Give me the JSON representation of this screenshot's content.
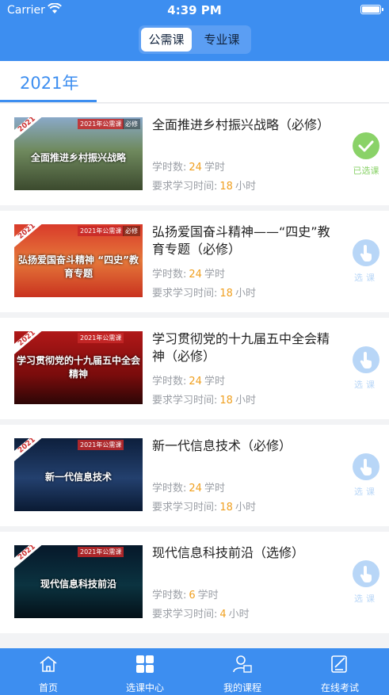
{
  "status": {
    "carrier": "Carrier",
    "time": "4:39 PM"
  },
  "header": {
    "tabs": [
      {
        "label": "公需课",
        "active": true
      },
      {
        "label": "专业课",
        "active": false
      }
    ]
  },
  "year_tab": "2021年",
  "courses": [
    {
      "thumb_tag": "2021年公需课",
      "thumb_req": "必修",
      "thumb_year": "2021",
      "thumb_headline": "全面推进乡村振兴战略",
      "title": "全面推进乡村振兴战略（必修）",
      "hours_label": "学时数:",
      "hours": "24",
      "hours_unit": "学时",
      "time_label": "要求学习时间:",
      "time": "18",
      "time_unit": "小时",
      "status": "已选课",
      "selected": true
    },
    {
      "thumb_tag": "2021年公需课",
      "thumb_req": "必修",
      "thumb_year": "2021",
      "thumb_headline": "弘扬爱国奋斗精神 “四史”教育专题",
      "title": "弘扬爱国奋斗精神——“四史”教育专题（必修）",
      "hours_label": "学时数:",
      "hours": "24",
      "hours_unit": "学时",
      "time_label": "要求学习时间:",
      "time": "18",
      "time_unit": "小时",
      "status": "选课",
      "selected": false
    },
    {
      "thumb_tag": "2021年公需课",
      "thumb_req": "",
      "thumb_year": "2021",
      "thumb_headline": "学习贯彻党的十九届五中全会精神",
      "title": "学习贯彻党的十九届五中全会精神（必修）",
      "hours_label": "学时数:",
      "hours": "24",
      "hours_unit": "学时",
      "time_label": "要求学习时间:",
      "time": "18",
      "time_unit": "小时",
      "status": "选课",
      "selected": false
    },
    {
      "thumb_tag": "2021年公需课",
      "thumb_req": "",
      "thumb_year": "2021",
      "thumb_headline": "新一代信息技术",
      "title": "新一代信息技术（必修）",
      "hours_label": "学时数:",
      "hours": "24",
      "hours_unit": "学时",
      "time_label": "要求学习时间:",
      "time": "18",
      "time_unit": "小时",
      "status": "选课",
      "selected": false
    },
    {
      "thumb_tag": "2021年公需课",
      "thumb_req": "",
      "thumb_year": "2021",
      "thumb_headline": "现代信息科技前沿",
      "title": "现代信息科技前沿（选修）",
      "hours_label": "学时数:",
      "hours": "6",
      "hours_unit": "学时",
      "time_label": "要求学习时间:",
      "time": "4",
      "time_unit": "小时",
      "status": "选课",
      "selected": false
    }
  ],
  "tabbar": [
    {
      "label": "首页",
      "icon": "home-icon"
    },
    {
      "label": "选课中心",
      "icon": "grid-icon"
    },
    {
      "label": "我的课程",
      "icon": "user-course-icon"
    },
    {
      "label": "在线考试",
      "icon": "exam-icon"
    }
  ]
}
